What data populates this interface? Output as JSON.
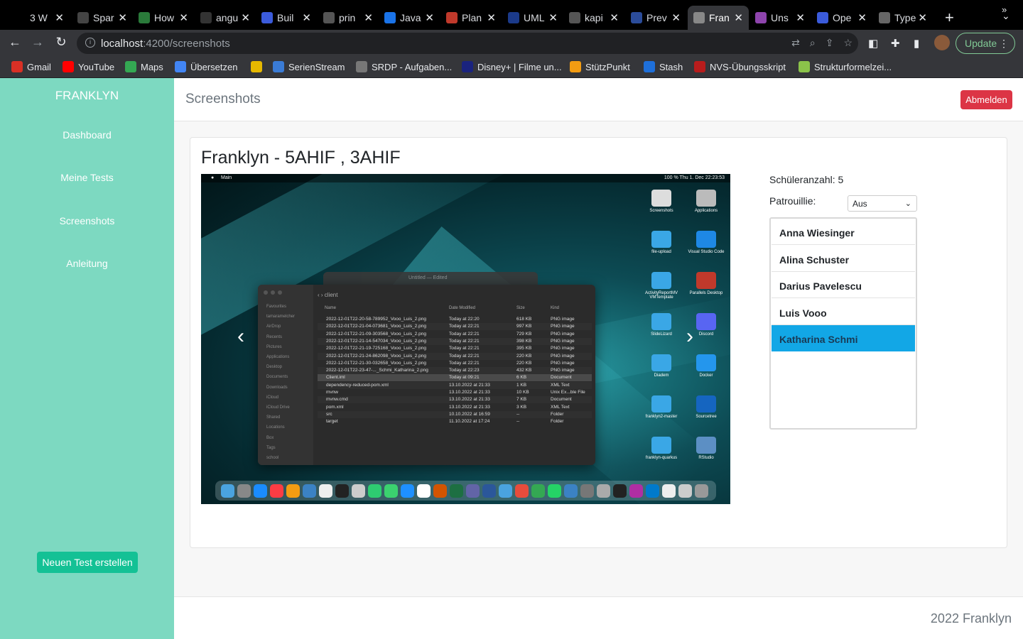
{
  "browser": {
    "tabs": [
      {
        "title": "3 W",
        "favicon": "dev-icon",
        "color": "#000000",
        "active": false
      },
      {
        "title": "Spar",
        "favicon": "spark-icon",
        "color": "#444444",
        "active": false
      },
      {
        "title": "How",
        "favicon": "infinity-icon",
        "color": "#2a7a3a",
        "active": false
      },
      {
        "title": "angu",
        "favicon": "github-icon",
        "color": "#333333",
        "active": false
      },
      {
        "title": "Buil",
        "favicon": "app-icon",
        "color": "#3b5bdb",
        "active": false
      },
      {
        "title": "prin",
        "favicon": "globe-icon",
        "color": "#555555",
        "active": false
      },
      {
        "title": "Java",
        "favicon": "a-icon",
        "color": "#1a73e8",
        "active": false
      },
      {
        "title": "Plan",
        "favicon": "chart-icon",
        "color": "#c0392b",
        "active": false
      },
      {
        "title": "UML",
        "favicon": "i-icon",
        "color": "#1b3a8a",
        "active": false
      },
      {
        "title": "kapi",
        "favicon": "globe-icon",
        "color": "#555555",
        "active": false
      },
      {
        "title": "Prev",
        "favicon": "co-icon",
        "color": "#2b4c9a",
        "active": false
      },
      {
        "title": "Fran",
        "favicon": "angular-icon",
        "color": "#888888",
        "active": true
      },
      {
        "title": "Uns",
        "favicon": "network-icon",
        "color": "#8e44ad",
        "active": false
      },
      {
        "title": "Ope",
        "favicon": "app-icon",
        "color": "#3b5bdb",
        "active": false
      },
      {
        "title": "Type",
        "favicon": "openai-icon",
        "color": "#666666",
        "active": false
      }
    ],
    "url_host": "localhost",
    "url_path": ":4200/screenshots",
    "update_label": "Update",
    "bookmarks": [
      {
        "label": "Gmail",
        "icon": "gmail-icon",
        "color": "#d93025"
      },
      {
        "label": "YouTube",
        "icon": "youtube-icon",
        "color": "#ff0000"
      },
      {
        "label": "Maps",
        "icon": "maps-icon",
        "color": "#34a853"
      },
      {
        "label": "Übersetzen",
        "icon": "translate-icon",
        "color": "#4285f4"
      },
      {
        "label": "",
        "icon": "x-icon",
        "color": "#e6b800"
      },
      {
        "label": "SerienStream",
        "icon": "play-icon",
        "color": "#3a7bd5"
      },
      {
        "label": "SRDP - Aufgaben...",
        "icon": "globe-icon",
        "color": "#777777"
      },
      {
        "label": "Disney+ | Filme un...",
        "icon": "disney-icon",
        "color": "#1a237e"
      },
      {
        "label": "StützPunkt",
        "icon": "stuetzpunkt-icon",
        "color": "#f39c12"
      },
      {
        "label": "Stash",
        "icon": "stash-icon",
        "color": "#1e6fd9"
      },
      {
        "label": "NVS-Übungsskript",
        "icon": "nvs-icon",
        "color": "#b71c1c"
      },
      {
        "label": "Strukturformelzei...",
        "icon": "molecule-icon",
        "color": "#8bc34a"
      }
    ]
  },
  "sidebar": {
    "brand": "FRANKLYN",
    "items": [
      "Dashboard",
      "Meine Tests",
      "Screenshots",
      "Anleitung"
    ],
    "new_test": "Neuen Test erstellen"
  },
  "header": {
    "title": "Screenshots",
    "logout": "Abmelden"
  },
  "card": {
    "title": "Franklyn - 5AHIF , 3AHIF",
    "student_count_label": "Schüleranzahl: 5",
    "patrol_label": "Patrouillie:",
    "patrol_value": "Aus",
    "students": [
      "Anna Wiesinger",
      "Alina Schuster",
      "Darius Pavelescu",
      "Luis Vooo",
      "Katharina Schmi"
    ],
    "selected_student_index": 4
  },
  "screenshot": {
    "menubar_left": "Main",
    "menubar_right": "100 %  Thu 1. Dec 22:23:53",
    "finder_title": "Untitled — Edited",
    "finder_folder": "client",
    "columns": [
      "Name",
      "Date Modified",
      "Size",
      "Kind"
    ],
    "sidebar": [
      "Favourites",
      "tamaramelcher",
      "AirDrop",
      "Recents",
      "Pictures",
      "Applications",
      "Desktop",
      "Documents",
      "Downloads",
      "iCloud",
      "iCloud Drive",
      "Shared",
      "Locations",
      "Box",
      "Tags",
      "school"
    ],
    "files": [
      [
        "2022-12-01T22-20-58-789952_Vooo_Luis_2.png",
        "Today at 22:20",
        "618 KB",
        "PNG image"
      ],
      [
        "2022-12-01T22-21-04-073681_Vooo_Luis_2.png",
        "Today at 22:21",
        "997 KB",
        "PNG image"
      ],
      [
        "2022-12-01T22-21-09-303568_Vooo_Luis_2.png",
        "Today at 22:21",
        "729 KB",
        "PNG image"
      ],
      [
        "2022-12-01T22-21-14-547034_Vooo_Luis_2.png",
        "Today at 22:21",
        "398 KB",
        "PNG image"
      ],
      [
        "2022-12-01T22-21-19-725168_Vooo_Luis_2.png",
        "Today at 22:21",
        "395 KB",
        "PNG image"
      ],
      [
        "2022-12-01T22-21-24-862098_Vooo_Luis_2.png",
        "Today at 22:21",
        "220 KB",
        "PNG image"
      ],
      [
        "2022-12-01T22-21-30-032658_Vooo_Luis_2.png",
        "Today at 22:21",
        "220 KB",
        "PNG image"
      ],
      [
        "2022-12-01T22-23-47-..._Schmi_Katharina_2.png",
        "Today at 22:23",
        "432 KB",
        "PNG image"
      ],
      [
        "Client.iml",
        "Today at 09:21",
        "6 KB",
        "Document"
      ],
      [
        "dependency-reduced-pom.xml",
        "13.10.2022 at 21:33",
        "1 KB",
        "XML Text"
      ],
      [
        "mvnw",
        "13.10.2022 at 21:33",
        "10 KB",
        "Unix Ex...ble File"
      ],
      [
        "mvnw.cmd",
        "13.10.2022 at 21:33",
        "7 KB",
        "Document"
      ],
      [
        "pom.xml",
        "13.10.2022 at 21:33",
        "3 KB",
        "XML Text"
      ],
      [
        "src",
        "10.10.2022 at 16:59",
        "--",
        "Folder"
      ],
      [
        "target",
        "11.10.2022 at 17:24",
        "--",
        "Folder"
      ]
    ],
    "desktop_icons": [
      "Screenshots",
      "Applications",
      "file-upload",
      "Visual Studio Code",
      "ActivityReportMV VMTemplate",
      "Parallels Desktop",
      "SlideLizard",
      "Discord",
      "Diadem",
      "Docker",
      "franklyn2-master",
      "Sourcetree",
      "franklyn-quarkus",
      "RStudio"
    ]
  },
  "footer": {
    "text": "2022 Franklyn"
  },
  "colors": {
    "sidebar": "#7dd9c1",
    "new_test": "#14c195",
    "logout": "#dc3545",
    "selected_student": "#12a7e6"
  }
}
